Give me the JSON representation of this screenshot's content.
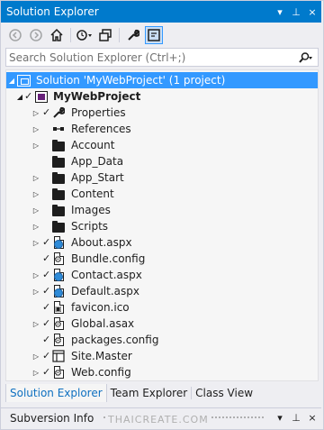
{
  "window": {
    "title": "Solution Explorer",
    "controls": [
      "▾",
      "⊥",
      "×"
    ]
  },
  "toolbar": {
    "buttons": [
      {
        "name": "back",
        "glyph": "◄",
        "disabled": true
      },
      {
        "name": "forward",
        "glyph": "►",
        "disabled": true
      },
      {
        "name": "home",
        "glyph": "⌂",
        "disabled": false
      },
      {
        "name": "sync-history",
        "glyph": "↻▾",
        "disabled": false
      },
      {
        "name": "collapse-all",
        "glyph": "⧉",
        "disabled": false
      },
      {
        "name": "properties",
        "glyph": "🔧",
        "disabled": false
      },
      {
        "name": "preview",
        "glyph": "⊡",
        "disabled": false
      }
    ]
  },
  "search": {
    "placeholder": "Search Solution Explorer (Ctrl+;)",
    "icon": "search-icon"
  },
  "tree": {
    "solution_label": "Solution 'MyWebProject' (1 project)",
    "project_label": "MyWebProject",
    "items": [
      {
        "label": "Properties",
        "icon": "wrench-icon",
        "expander": true,
        "checked": true
      },
      {
        "label": "References",
        "icon": "references-icon",
        "expander": true,
        "checked": false
      },
      {
        "label": "Account",
        "icon": "folder-icon",
        "expander": true,
        "checked": false
      },
      {
        "label": "App_Data",
        "icon": "folder-icon",
        "expander": false,
        "checked": false
      },
      {
        "label": "App_Start",
        "icon": "folder-icon",
        "expander": true,
        "checked": false
      },
      {
        "label": "Content",
        "icon": "folder-icon",
        "expander": true,
        "checked": false
      },
      {
        "label": "Images",
        "icon": "folder-icon",
        "expander": true,
        "checked": false
      },
      {
        "label": "Scripts",
        "icon": "folder-icon",
        "expander": true,
        "checked": false
      },
      {
        "label": "About.aspx",
        "icon": "aspx-icon",
        "expander": true,
        "checked": true
      },
      {
        "label": "Bundle.config",
        "icon": "config-icon",
        "expander": false,
        "checked": true
      },
      {
        "label": "Contact.aspx",
        "icon": "aspx-icon",
        "expander": true,
        "checked": true
      },
      {
        "label": "Default.aspx",
        "icon": "aspx-icon",
        "expander": true,
        "checked": true
      },
      {
        "label": "favicon.ico",
        "icon": "image-file-icon",
        "expander": false,
        "checked": true
      },
      {
        "label": "Global.asax",
        "icon": "config-icon",
        "expander": true,
        "checked": true
      },
      {
        "label": "packages.config",
        "icon": "config-icon",
        "expander": false,
        "checked": true
      },
      {
        "label": "Site.Master",
        "icon": "master-icon",
        "expander": true,
        "checked": true
      },
      {
        "label": "Web.config",
        "icon": "config-icon",
        "expander": true,
        "checked": true
      }
    ]
  },
  "tabs": [
    "Solution Explorer",
    "Team Explorer",
    "Class View"
  ],
  "bottom_panel": {
    "title": "Subversion Info",
    "controls": [
      "▾",
      "⊥",
      "×"
    ]
  },
  "watermark": "THAICREATE.COM",
  "colors": {
    "accent": "#007acc",
    "selection": "#3399ff",
    "background": "#eeeef2"
  }
}
